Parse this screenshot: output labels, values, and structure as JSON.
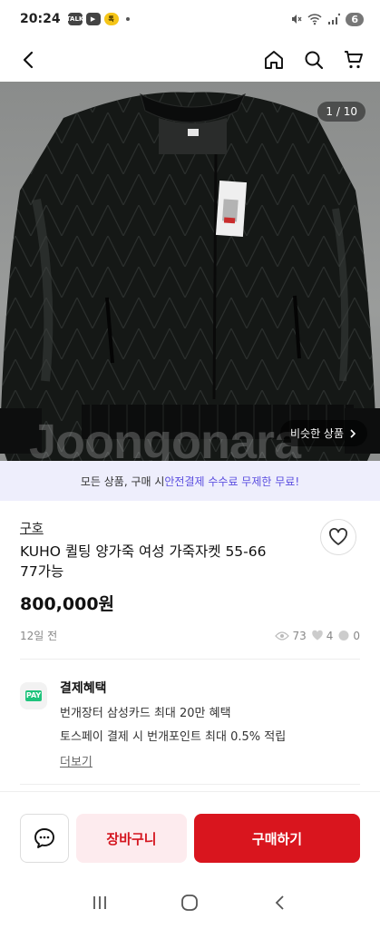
{
  "status_bar": {
    "time": "20:24",
    "notif_icons": [
      "talk-icon",
      "youtube-icon",
      "kakao-icon"
    ],
    "notif_labels": [
      "TALK",
      "▶",
      "톡"
    ],
    "battery_level": "6"
  },
  "photo": {
    "counter": "1 / 10",
    "similar_label": "비슷한 상품",
    "watermark": "Joongonara"
  },
  "promo": {
    "prefix": "모든 상품, 구매 시 ",
    "highlight": "안전결제 수수료 무제한 무료!"
  },
  "product": {
    "shop_name": "구호",
    "title": "KUHO 퀼팅 양가죽 여성 가죽자켓 55-66 77가능",
    "price": "800,000원",
    "posted": "12일 전",
    "views": "73",
    "likes": "4",
    "chats": "0"
  },
  "benefit": {
    "icon_label": "PAY",
    "heading": "결제혜택",
    "line1": "번개장터 삼성카드 최대 20만 혜택",
    "line2": "토스페이 결제 시 번개포인트 최대 0.5% 적립",
    "more": "더보기"
  },
  "actions": {
    "cart": "장바구니",
    "buy": "구매하기"
  },
  "colors": {
    "accent_red": "#d9151e",
    "promo_bg": "#eeeefc",
    "promo_highlight": "#5b4ee0"
  }
}
